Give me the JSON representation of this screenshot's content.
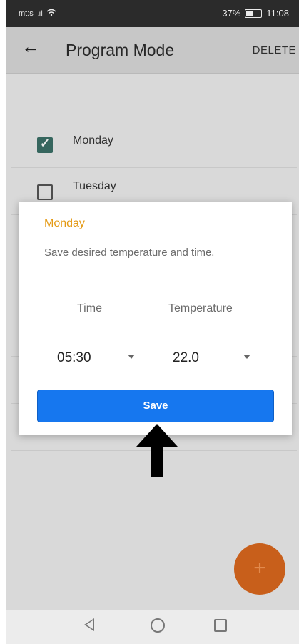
{
  "status_bar": {
    "carrier": "mt:s",
    "battery_percent": "37%",
    "time": "11:08",
    "battery_level": 0.37,
    "icons": [
      "signal-icon",
      "wifi-icon",
      "battery-icon"
    ]
  },
  "app_bar": {
    "back_icon": "arrow-left-icon",
    "title": "Program Mode",
    "delete_label": "DELETE"
  },
  "days": [
    {
      "label": "Monday",
      "checked": true
    },
    {
      "label": "Tuesday",
      "checked": false
    }
  ],
  "dialog": {
    "title": "Monday",
    "subtitle": "Save desired temperature and time.",
    "time_label": "Time",
    "temperature_label": "Temperature",
    "time_value": "05:30",
    "temperature_value": "22.0",
    "save_label": "Save"
  },
  "fab": {
    "label": "+"
  },
  "colors": {
    "accent_orange": "#e49a15",
    "save_blue": "#1677ef",
    "fab_orange": "#c85f1b",
    "checkbox_green": "#3b6f66"
  },
  "nav_bar": {
    "icons": [
      "nav-back-icon",
      "nav-home-icon",
      "nav-recent-icon"
    ]
  }
}
